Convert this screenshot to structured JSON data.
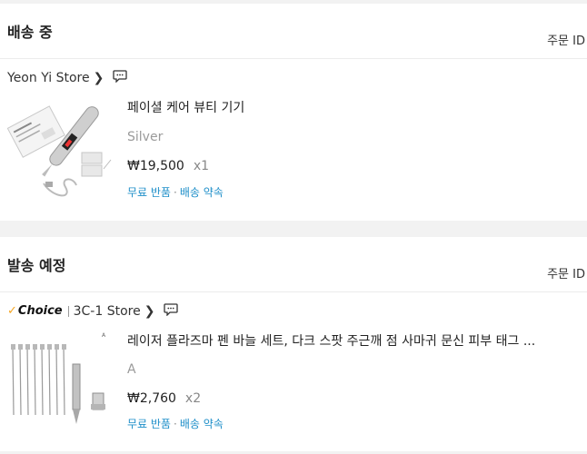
{
  "sections": [
    {
      "title": "배송 중",
      "order_id_label": "주문 ID",
      "store_name": "Yeon Yi Store",
      "product_name": "페이셜 케어 뷰티 기기",
      "variant": "Silver",
      "price": "₩19,500",
      "qty": "x1",
      "tag1": "무료 반품",
      "tag2": "배송 약속",
      "thumb_icon": "beauty-pen-product-image"
    },
    {
      "title": "발송 예정",
      "order_id_label": "주문 ID",
      "store_badge": "Choice",
      "store_name": "3C-1 Store",
      "product_name": "레이저 플라즈마 펜 바늘 세트, 다크 스팟 주근깨 점 사마귀 문신 피부 태그 ...",
      "variant": "A",
      "price": "₩2,760",
      "qty": "x2",
      "tag1": "무료 반품",
      "tag2": "배송 약속",
      "thumb_icon": "needle-set-product-image"
    }
  ],
  "colors": {
    "link_blue": "#1f8fc9",
    "choice_check": "#f5a623",
    "muted": "#9a9a9a"
  }
}
